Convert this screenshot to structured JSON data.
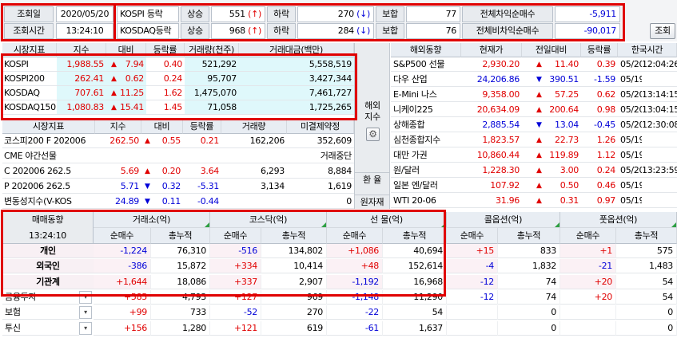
{
  "top": {
    "query_date_label": "조회일",
    "query_date": "2020/05/20",
    "query_time_label": "조회시간",
    "query_time": "13:24:10",
    "kospi_label": "KOSPI 등락",
    "kosdaq_label": "KOSDAQ등락",
    "up_label": "상승",
    "down_label": "하락",
    "flat_label": "보합",
    "kospi_up": "551",
    "kospi_down": "270",
    "kospi_flat": "77",
    "kosdaq_up": "968",
    "kosdaq_down": "284",
    "kosdaq_flat": "76",
    "up_arrow": "(↑)",
    "down_arrow": "(↓)",
    "net_buy_arb_label": "전체차익순매수",
    "net_buy_arb": "-5,911",
    "net_buy_nonarb_label": "전체비차익순매수",
    "net_buy_nonarb": "-90,017",
    "query_button": "조회"
  },
  "indices": {
    "headers": [
      "시장지표",
      "지수",
      "대비",
      "등락률",
      "거래량(천주)",
      "거래대금(백만)"
    ],
    "rows": [
      {
        "name": "KOSPI",
        "index": "1,988.55",
        "arrow": "▲",
        "change": "7.94",
        "rate": "0.40",
        "volume": "521,292",
        "amount": "5,558,519"
      },
      {
        "name": "KOSPI200",
        "index": "262.41",
        "arrow": "▲",
        "change": "0.62",
        "rate": "0.24",
        "volume": "95,707",
        "amount": "3,427,344"
      },
      {
        "name": "KOSDAQ",
        "index": "707.61",
        "arrow": "▲",
        "change": "11.25",
        "rate": "1.62",
        "volume": "1,475,070",
        "amount": "7,461,727"
      },
      {
        "name": "KOSDAQ150",
        "index": "1,080.83",
        "arrow": "▲",
        "change": "15.41",
        "rate": "1.45",
        "volume": "71,058",
        "amount": "1,725,265"
      }
    ]
  },
  "derivs": {
    "headers": [
      "시장지표",
      "지수",
      "대비",
      "등락률",
      "거래량",
      "미결제약정"
    ],
    "rows": [
      {
        "name": "코스피200 F 202006",
        "index": "262.50",
        "arrow": "▲",
        "change": "0.55",
        "rate": "0.21",
        "volume": "162,206",
        "oi": "352,609",
        "color": "red"
      },
      {
        "name": "CME 야간선물",
        "index": "",
        "arrow": "",
        "change": "",
        "rate": "",
        "volume": "",
        "oi": "거래중단",
        "color": ""
      },
      {
        "name": "C 202006 262.5",
        "index": "5.69",
        "arrow": "▲",
        "change": "0.20",
        "rate": "3.64",
        "volume": "6,293",
        "oi": "8,884",
        "color": "red"
      },
      {
        "name": "P 202006 262.5",
        "index": "5.71",
        "arrow": "▼",
        "change": "0.32",
        "rate": "-5.31",
        "volume": "3,134",
        "oi": "1,619",
        "color": "blue"
      },
      {
        "name": "변동성지수(V-KOS",
        "index": "24.89",
        "arrow": "▼",
        "change": "0.11",
        "rate": "-0.44",
        "volume": "",
        "oi": "0",
        "color": "blue"
      }
    ]
  },
  "side": {
    "overseas": "해외\n지수",
    "fx": "환 율",
    "raw": "원자재"
  },
  "world": {
    "headers": [
      "해외동향",
      "현재가",
      "전일대비",
      "등락률",
      "한국시간"
    ],
    "rows": [
      {
        "name": "S&P500 선물",
        "price": "2,930.20",
        "arrow": "▲",
        "change": "11.40",
        "rate": "0.39",
        "date": "05/20",
        "time": "12:04:26",
        "color": "red"
      },
      {
        "name": "다우 산업",
        "price": "24,206.86",
        "arrow": "▼",
        "change": "390.51",
        "rate": "-1.59",
        "date": "05/19",
        "time": "",
        "color": "blue"
      },
      {
        "name": "E-Mini 나스",
        "price": "9,358.00",
        "arrow": "▲",
        "change": "57.25",
        "rate": "0.62",
        "date": "05/20",
        "time": "13:14:15",
        "color": "red"
      },
      {
        "name": "니케이225",
        "price": "20,634.09",
        "arrow": "▲",
        "change": "200.64",
        "rate": "0.98",
        "date": "05/20",
        "time": "13:04:15",
        "color": "red"
      },
      {
        "name": "상해종합",
        "price": "2,885.54",
        "arrow": "▼",
        "change": "13.04",
        "rate": "-0.45",
        "date": "05/20",
        "time": "12:30:08",
        "color": "blue"
      },
      {
        "name": "심천종합지수",
        "price": "1,823.57",
        "arrow": "▲",
        "change": "22.73",
        "rate": "1.26",
        "date": "05/19",
        "time": "",
        "color": "red"
      },
      {
        "name": "대만 가권",
        "price": "10,860.44",
        "arrow": "▲",
        "change": "119.89",
        "rate": "1.12",
        "date": "05/19",
        "time": "",
        "color": "red"
      },
      {
        "name": "원/달러",
        "price": "1,228.30",
        "arrow": "▲",
        "change": "3.00",
        "rate": "0.24",
        "date": "05/20",
        "time": "13:23:59",
        "color": "red"
      },
      {
        "name": "일본 엔/달러",
        "price": "107.92",
        "arrow": "▲",
        "change": "0.50",
        "rate": "0.46",
        "date": "05/19",
        "time": "",
        "color": "red"
      },
      {
        "name": "WTI 20-06",
        "price": "31.96",
        "arrow": "▲",
        "change": "0.31",
        "rate": "0.97",
        "date": "05/19",
        "time": "",
        "color": "red"
      }
    ]
  },
  "flows": {
    "title": "매매동향",
    "time": "13:24:10",
    "groups": [
      "거래소(억)",
      "코스닥(억)",
      "선 물(억)",
      "콜옵션(억)",
      "풋옵션(억)"
    ],
    "sub_net": "순매수",
    "sub_cum": "총누적",
    "rows": [
      {
        "name": "개인",
        "v": [
          "-1,224",
          "76,310",
          "-516",
          "134,802",
          "+1,086",
          "40,694",
          "+15",
          "833",
          "+1",
          "575"
        ],
        "bold": true,
        "dd": false
      },
      {
        "name": "외국인",
        "v": [
          "-386",
          "15,872",
          "+334",
          "10,414",
          "+48",
          "152,614",
          "-4",
          "1,832",
          "-21",
          "1,483"
        ],
        "bold": true,
        "dd": false
      },
      {
        "name": "기관계",
        "v": [
          "+1,644",
          "18,086",
          "+337",
          "2,907",
          "-1,192",
          "16,968",
          "-12",
          "74",
          "+20",
          "54"
        ],
        "bold": true,
        "dd": false
      },
      {
        "name": "금융투자",
        "v": [
          "+585",
          "4,793",
          "+127",
          "969",
          "-1,148",
          "11,290",
          "-12",
          "74",
          "+20",
          "54"
        ],
        "bold": false,
        "dd": true
      },
      {
        "name": "보험",
        "v": [
          "+99",
          "733",
          "-52",
          "270",
          "-22",
          "54",
          "",
          "0",
          "",
          "0"
        ],
        "bold": false,
        "dd": true
      },
      {
        "name": "투신",
        "v": [
          "+156",
          "1,280",
          "+121",
          "619",
          "-61",
          "1,637",
          "",
          "0",
          "",
          "0"
        ],
        "bold": false,
        "dd": true
      }
    ]
  },
  "colors": {
    "up": "#e00000",
    "down": "#0000d8",
    "highlight": "#e00000"
  }
}
